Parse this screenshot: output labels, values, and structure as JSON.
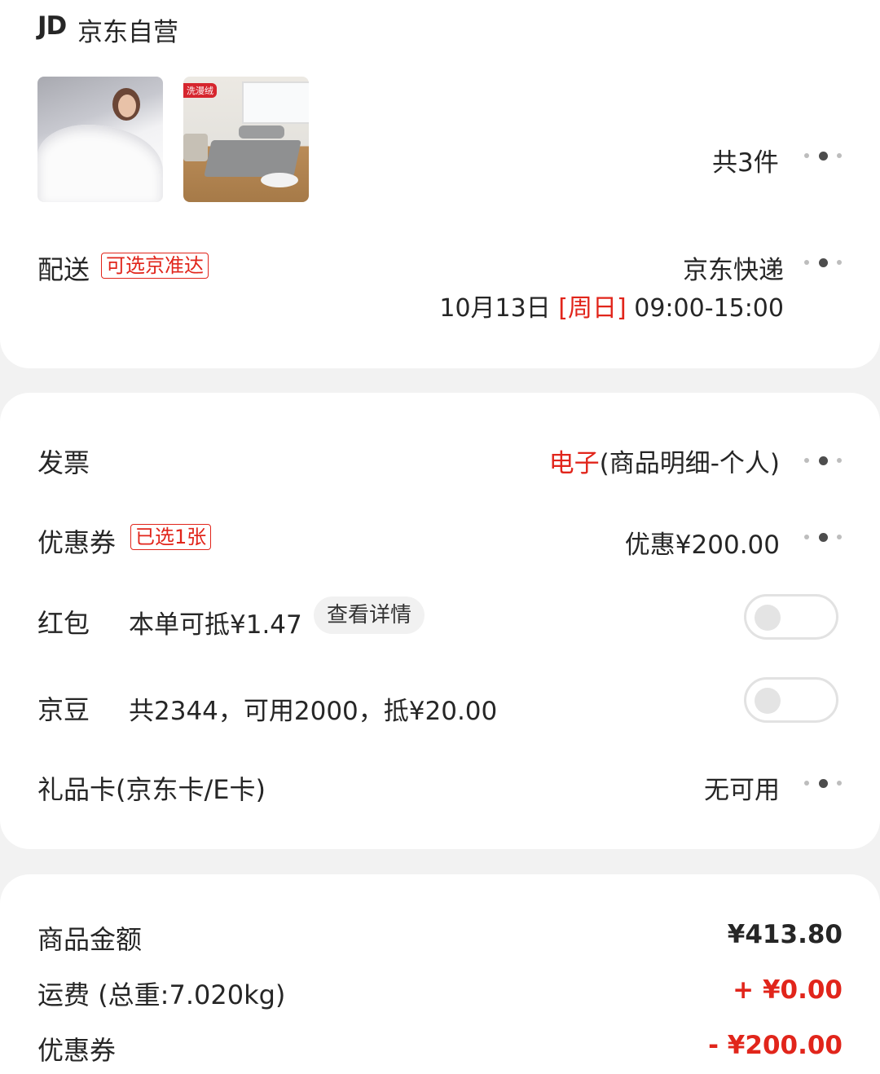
{
  "shop": {
    "logo": "JD",
    "name": "京东自营"
  },
  "products": {
    "thumbnails": [
      {
        "icon": "quilt-product-image"
      },
      {
        "icon": "bedsheet-product-image",
        "brand_tag": "洗漫绒"
      }
    ],
    "count_text": "共3件"
  },
  "delivery": {
    "label": "配送",
    "badge": "可选京准达",
    "method": "京东快递",
    "date": "10月13日",
    "weekday": "[周日]",
    "time": "09:00-15:00"
  },
  "invoice": {
    "label": "发票",
    "type": "电子",
    "detail": "(商品明细-个人)"
  },
  "coupon": {
    "label": "优惠券",
    "badge": "已选1张",
    "value": "优惠¥200.00"
  },
  "red_packet": {
    "label": "红包",
    "desc": "本单可抵¥1.47",
    "detail_button": "查看详情",
    "enabled": false
  },
  "jd_beans": {
    "label": "京豆",
    "desc": "共2344，可用2000，抵¥20.00",
    "enabled": false
  },
  "gift_card": {
    "label": "礼品卡(京东卡/E卡)",
    "value": "无可用"
  },
  "summary": {
    "goods_label": "商品金额",
    "goods_value": "¥413.80",
    "shipping_label": "运费",
    "shipping_weight": "(总重:7.020kg)",
    "shipping_value": "+ ¥0.00",
    "coupon_label": "优惠券",
    "coupon_value": "- ¥200.00"
  },
  "colors": {
    "accent": "#e1251b",
    "background": "#f2f2f2",
    "card": "#ffffff"
  }
}
